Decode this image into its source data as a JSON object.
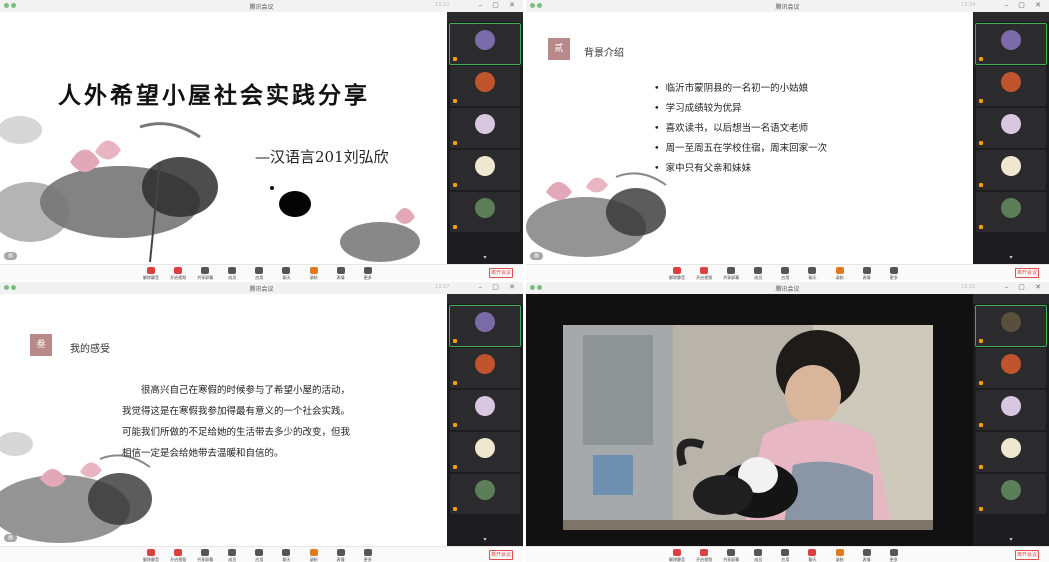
{
  "window_title": "腾讯会议",
  "view_mode": "画",
  "toolbar": {
    "items": [
      "解除静音",
      "开启视频",
      "共享屏幕",
      "成员",
      "应用",
      "聊天",
      "录制",
      "表情",
      "更多"
    ],
    "leave": "离开会议"
  },
  "panels": [
    {
      "clock": "13:22",
      "slide": {
        "title": "人外希望小屋社会实践分享",
        "author": "—汉语言201刘弘欣"
      }
    },
    {
      "clock": "13:24",
      "slide": {
        "badge": "贰",
        "heading": "背景介绍",
        "bullets": [
          "临沂市蒙阴县的一名初一的小姑娘",
          "学习成绩较为优异",
          "喜欢读书，以后想当一名语文老师",
          "周一至周五在学校住宿，周末回家一次",
          "家中只有父亲和妹妹"
        ]
      }
    },
    {
      "clock": "13:27",
      "slide": {
        "badge": "叁",
        "heading": "我的感受",
        "paragraph": "很高兴自己在寒假的时候参与了希望小屋的活动，我觉得这是在寒假我参加得最有意义的一个社会实践。可能我们所做的不足给她的生活带去多少的改变，但我相信一定是会给她带去温暖和自信的。"
      }
    },
    {
      "clock": "13:31",
      "slide": {}
    }
  ],
  "colors": {
    "accent_badge": "#b98888",
    "leave_red": "#e05050",
    "active_green": "#3fae55"
  }
}
